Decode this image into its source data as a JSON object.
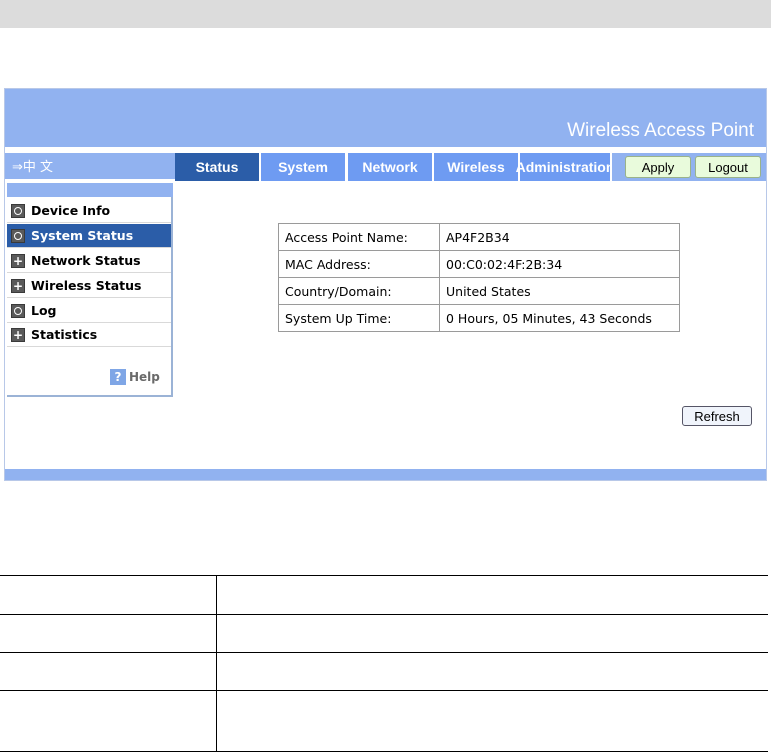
{
  "header": {
    "title": "Wireless Access Point"
  },
  "lang": {
    "label": "⇒中 文"
  },
  "tabs": [
    {
      "label": "Status",
      "active": true
    },
    {
      "label": "System",
      "active": false
    },
    {
      "label": "Network",
      "active": false
    },
    {
      "label": "Wireless",
      "active": false
    },
    {
      "label": "Administration",
      "active": false
    }
  ],
  "buttons": {
    "apply": "Apply",
    "logout": "Logout",
    "refresh": "Refresh"
  },
  "menu": {
    "items": [
      {
        "label": "Device Info",
        "icon": "circle-icon"
      },
      {
        "label": "System Status",
        "icon": "circle-icon",
        "active": true
      },
      {
        "label": "Network Status",
        "icon": "plus-icon"
      },
      {
        "label": "Wireless Status",
        "icon": "plus-icon"
      },
      {
        "label": "Log",
        "icon": "circle-icon"
      },
      {
        "label": "Statistics",
        "icon": "plus-icon"
      }
    ],
    "help_icon": "?",
    "help": "Help"
  },
  "info": {
    "rows": [
      {
        "key": "Access Point Name:",
        "value": "AP4F2B34"
      },
      {
        "key": "MAC Address:",
        "value": "00:C0:02:4F:2B:34"
      },
      {
        "key": "Country/Domain:",
        "value": "United States"
      },
      {
        "key": "System Up Time:",
        "value": "0 Hours, 05 Minutes, 43 Seconds"
      }
    ]
  },
  "colors": {
    "header": "#91b2f0",
    "tab": "#6e9bf2",
    "tab_active": "#2b5da8"
  }
}
